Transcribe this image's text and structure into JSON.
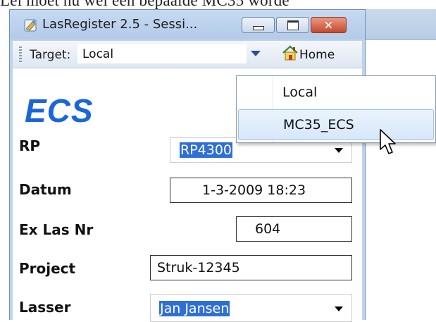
{
  "background_doc_text": "Lei moet nu wel een bepaalde MC35 worde",
  "window": {
    "title": "LasRegister 2.5 - Sessi...",
    "caption_buttons": [
      "minimize",
      "maximize",
      "close"
    ],
    "close_glyph": "✕"
  },
  "toolbar": {
    "target_label": "Target:",
    "target_value": "Local",
    "home_label": "Home"
  },
  "logo": "ECS",
  "form": {
    "rp": {
      "label": "RP",
      "value": "RP4300"
    },
    "datum": {
      "label": "Datum",
      "value": "1-3-2009 18:23"
    },
    "ex_las_nr": {
      "label": "Ex Las Nr",
      "value": "604"
    },
    "project": {
      "label": "Project",
      "value": "Struk-12345"
    },
    "lasser": {
      "label": "Lasser",
      "value": "Jan Jansen"
    }
  },
  "dropdown": {
    "items": [
      {
        "label": "Local",
        "hovered": false
      },
      {
        "label": "MC35_ECS",
        "hovered": true
      }
    ]
  },
  "colors": {
    "logo": "#1a66d6",
    "selection": "#2f6fd5",
    "window_frame": "#bed3ec"
  },
  "icons": [
    "app-icon",
    "home-icon",
    "dropdown-arrow-icon",
    "mouse-cursor-icon"
  ]
}
